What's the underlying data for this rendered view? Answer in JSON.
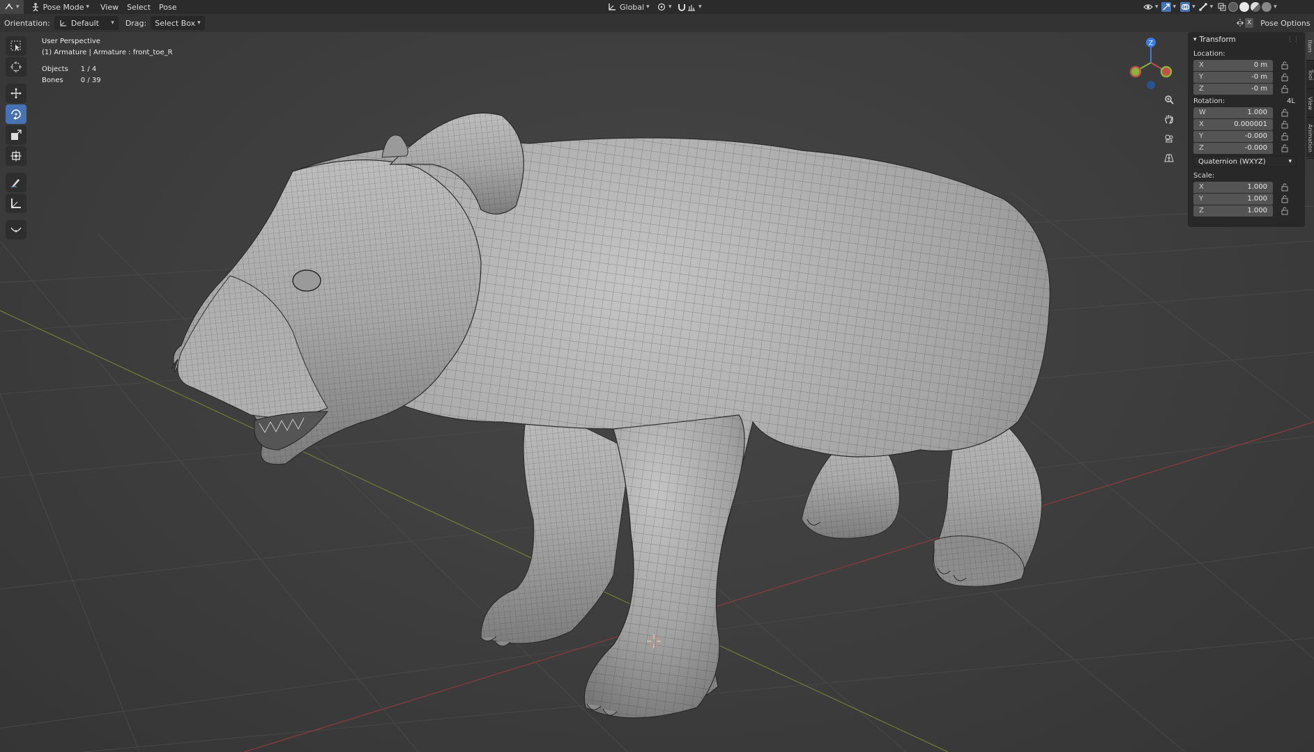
{
  "header": {
    "mode_label": "Pose Mode",
    "menus": [
      "View",
      "Select",
      "Pose"
    ],
    "transform_orientation": "Global"
  },
  "tool_settings": {
    "orientation_label": "Orientation:",
    "orientation_value": "Default",
    "drag_label": "Drag:",
    "drag_value": "Select Box",
    "options_label": "Pose Options"
  },
  "viewport": {
    "view_name": "User Perspective",
    "active_info": "(1) Armature | Armature : front_toe_R",
    "stats": [
      {
        "label": "Objects",
        "value": "1 / 4"
      },
      {
        "label": "Bones",
        "value": "0 / 39"
      }
    ],
    "gizmo_axis": "Z"
  },
  "n_panel": {
    "section_title": "Transform",
    "location_label": "Location:",
    "location": [
      {
        "axis": "X",
        "value": "0 m"
      },
      {
        "axis": "Y",
        "value": "-0 m"
      },
      {
        "axis": "Z",
        "value": "-0 m"
      }
    ],
    "rotation_label": "Rotation:",
    "rotation_mode_short": "4L",
    "rotation": [
      {
        "axis": "W",
        "value": "1.000"
      },
      {
        "axis": "X",
        "value": "0.000001"
      },
      {
        "axis": "Y",
        "value": "-0.000"
      },
      {
        "axis": "Z",
        "value": "-0.000"
      }
    ],
    "rotation_mode": "Quaternion (WXYZ)",
    "scale_label": "Scale:",
    "scale": [
      {
        "axis": "X",
        "value": "1.000"
      },
      {
        "axis": "Y",
        "value": "1.000"
      },
      {
        "axis": "Z",
        "value": "1.000"
      }
    ],
    "tabs": [
      "Item",
      "Tool",
      "View",
      "Animation"
    ]
  },
  "colors": {
    "accent": "#4772b3",
    "x_axis": "#c0504d",
    "y_axis": "#8bb43c",
    "z_axis": "#3d7be0",
    "viewport_bg": "#3d3d3d"
  },
  "icons": {
    "tools": [
      "select-box-icon",
      "cursor-icon",
      "move-icon",
      "rotate-icon",
      "scale-icon",
      "transform-icon",
      "annotate-icon",
      "measure-icon",
      "relax-pose-icon"
    ],
    "nav": [
      "zoom-icon",
      "pan-hand-icon",
      "camera-view-icon",
      "ortho-grid-icon"
    ]
  }
}
